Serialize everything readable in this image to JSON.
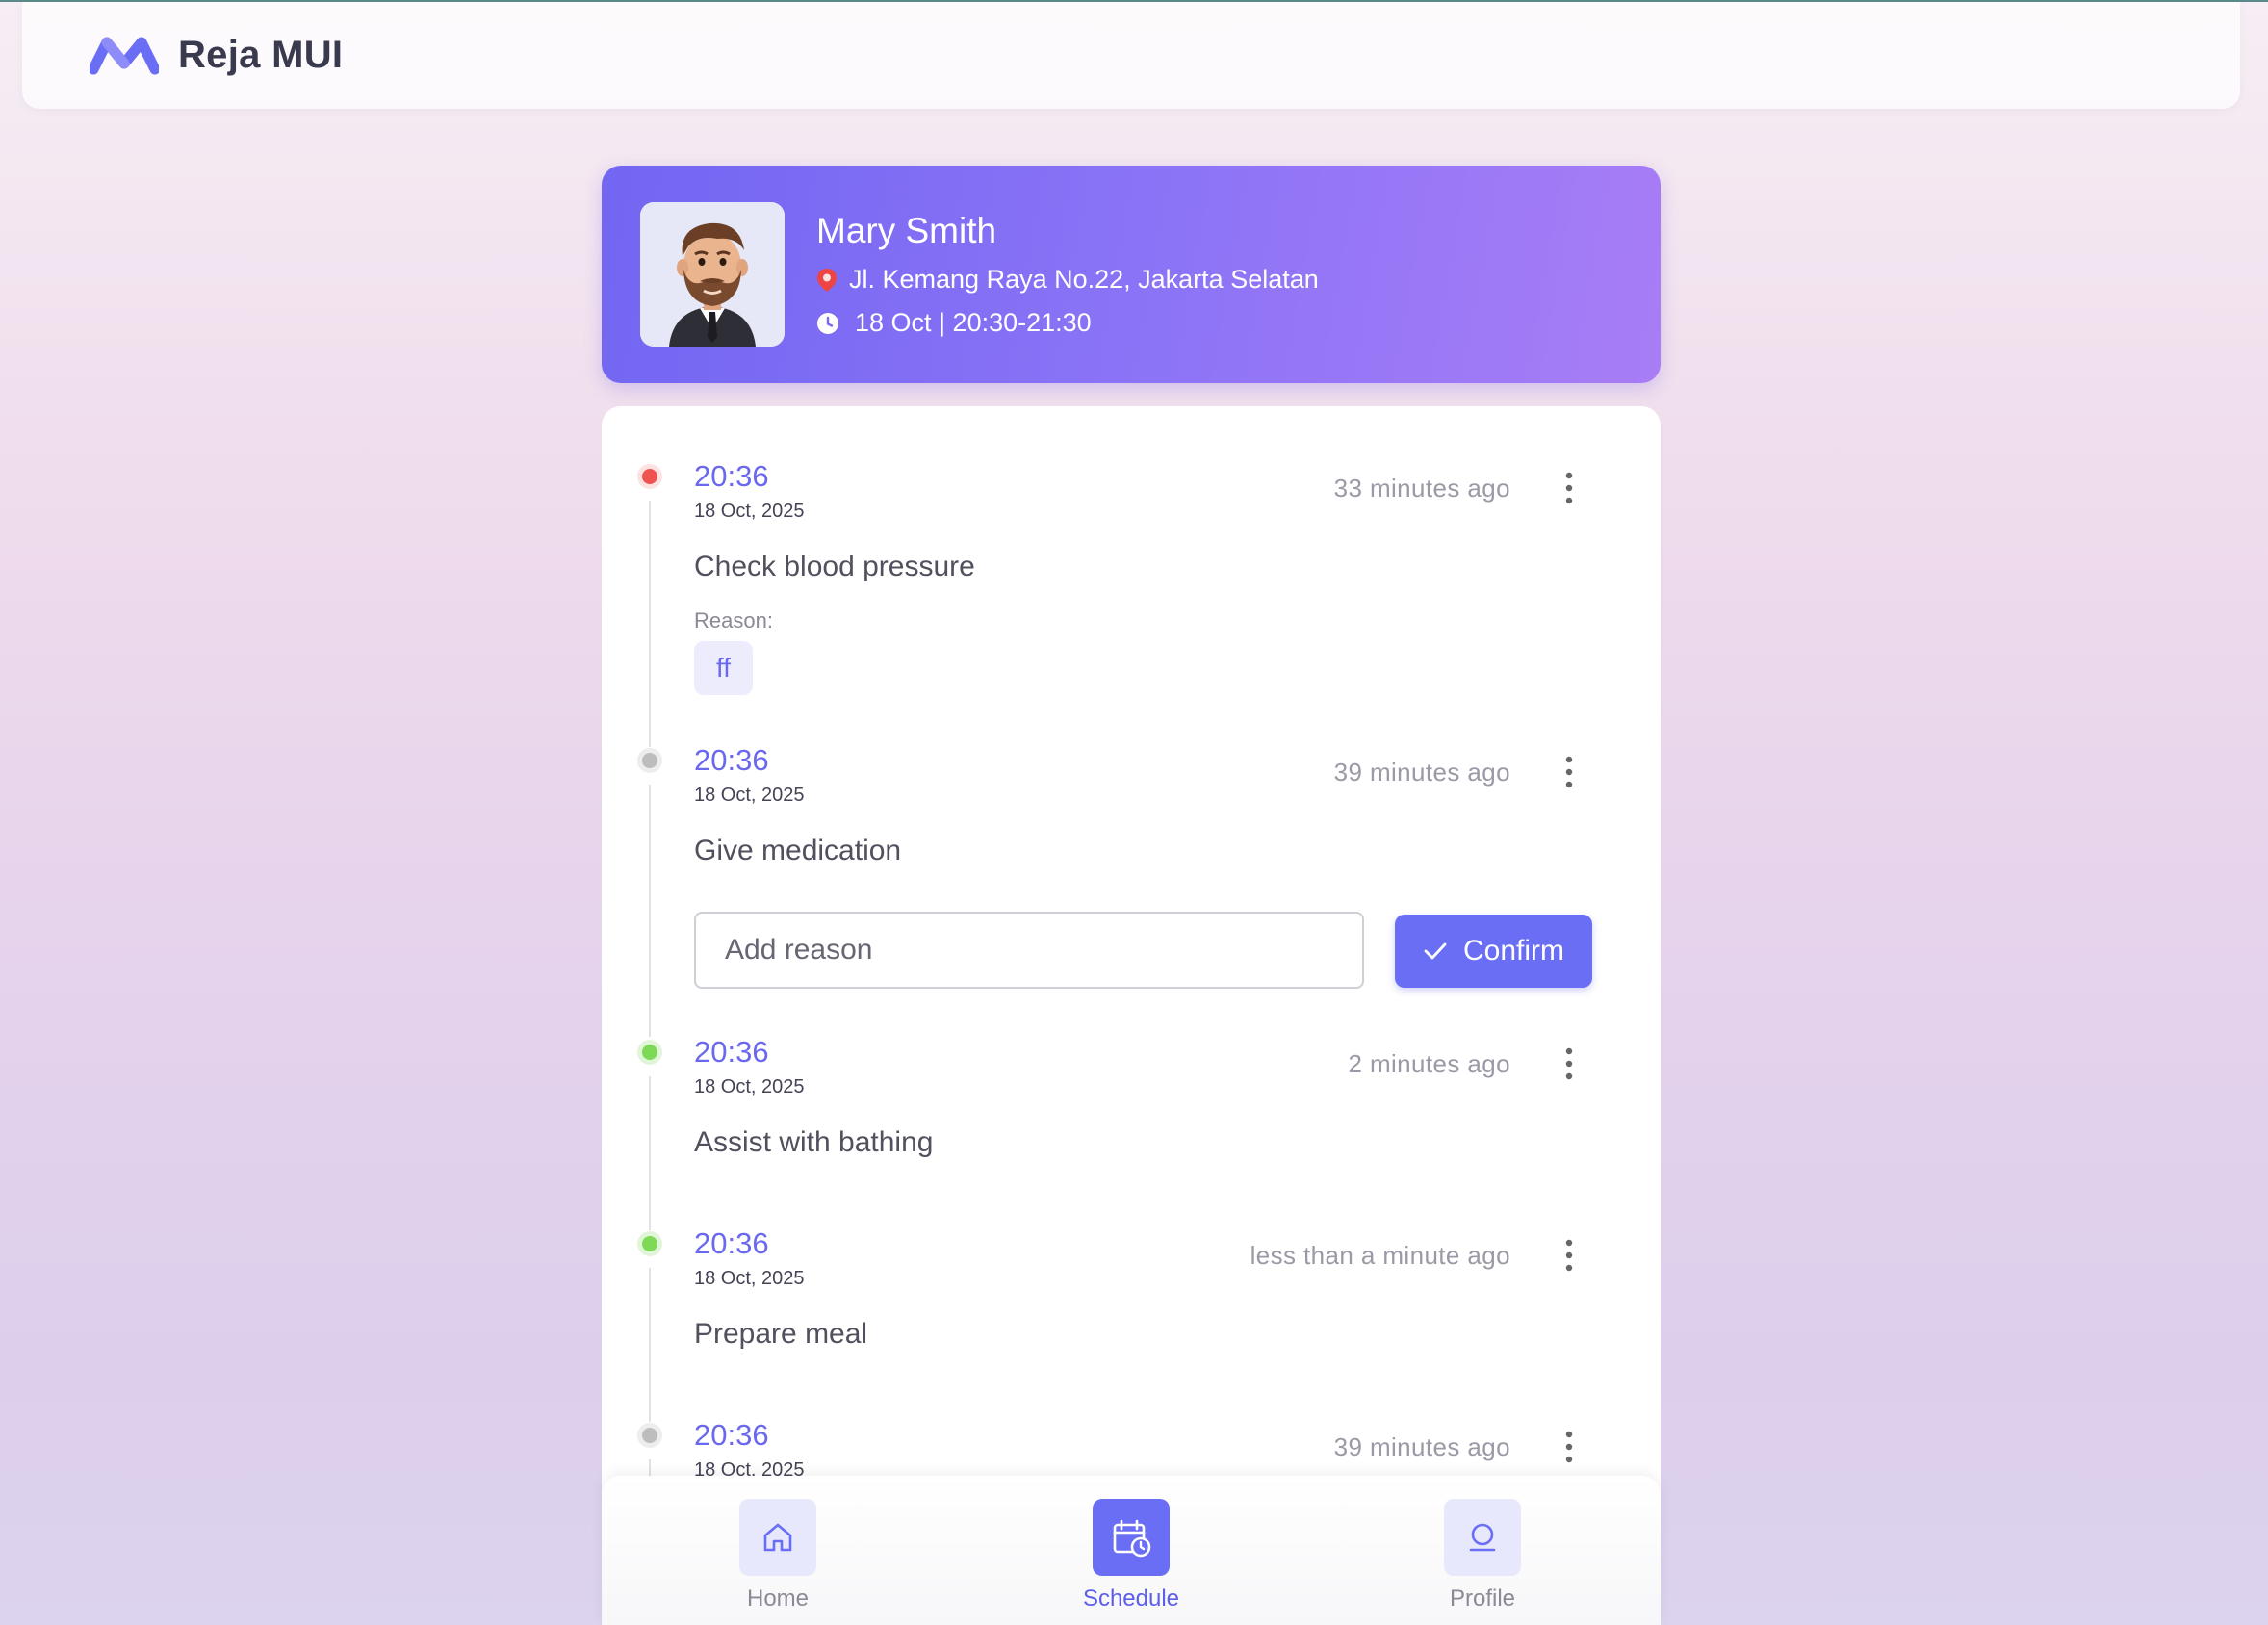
{
  "app": {
    "brand": "Reja MUI"
  },
  "header": {
    "patient_name": "Mary Smith",
    "address": "Jl. Kemang Raya No.22, Jakarta Selatan",
    "schedule": "18 Oct | 20:30-21:30"
  },
  "timeline": [
    {
      "time": "20:36",
      "date": "18 Oct, 2025",
      "relative": "33 minutes ago",
      "task": "Check blood pressure",
      "status_color": "red",
      "reason_label": "Reason:",
      "reason": "ff"
    },
    {
      "time": "20:36",
      "date": "18 Oct, 2025",
      "relative": "39 minutes ago",
      "task": "Give medication",
      "status_color": "grey",
      "input_placeholder": "Add reason",
      "confirm_label": "Confirm"
    },
    {
      "time": "20:36",
      "date": "18 Oct, 2025",
      "relative": "2 minutes ago",
      "task": "Assist with bathing",
      "status_color": "green"
    },
    {
      "time": "20:36",
      "date": "18 Oct, 2025",
      "relative": "less than a minute ago",
      "task": "Prepare meal",
      "status_color": "green"
    },
    {
      "time": "20:36",
      "date": "18 Oct, 2025",
      "relative": "39 minutes ago",
      "status_color": "grey"
    }
  ],
  "bottom_nav": [
    {
      "label": "Home",
      "icon": "home-icon",
      "active": false
    },
    {
      "label": "Schedule",
      "icon": "calendar-clock-icon",
      "active": true
    },
    {
      "label": "Profile",
      "icon": "user-icon",
      "active": false
    }
  ],
  "colors": {
    "accent": "#6a6ef5",
    "status_red": "#ef5350",
    "status_grey": "#bdbdbd",
    "status_green": "#7ed957"
  }
}
